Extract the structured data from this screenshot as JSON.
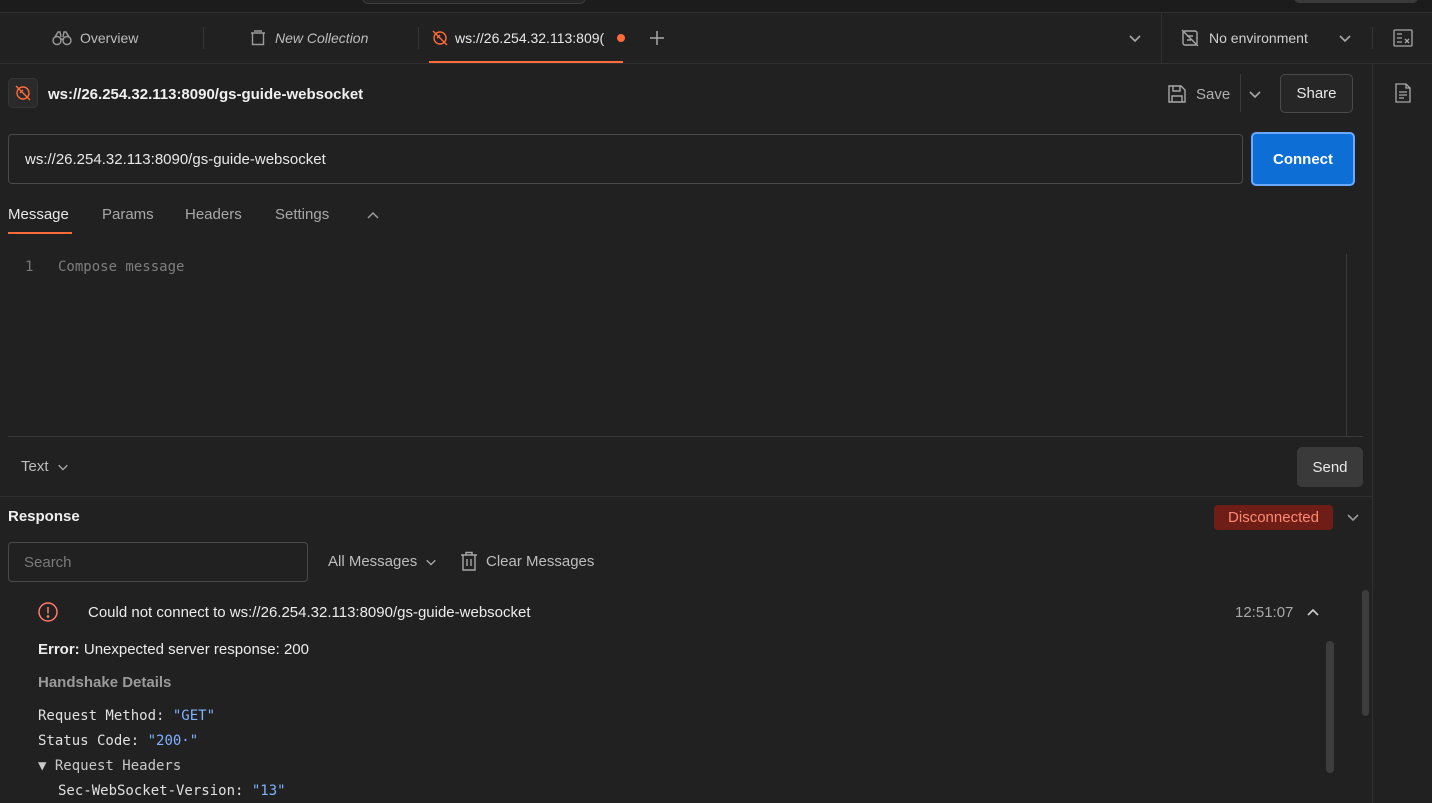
{
  "tabs": {
    "overview": "Overview",
    "collection": "New Collection",
    "active": "ws://26.254.32.113:809(",
    "environment": "No environment"
  },
  "request": {
    "title": "ws://26.254.32.113:8090/gs-guide-websocket",
    "url": "ws://26.254.32.113:8090/gs-guide-websocket",
    "save_label": "Save",
    "share_label": "Share",
    "connect_label": "Connect"
  },
  "subtabs": {
    "message": "Message",
    "params": "Params",
    "headers": "Headers",
    "settings": "Settings"
  },
  "editor": {
    "line_number": "1",
    "placeholder": "Compose message",
    "format": "Text",
    "send_label": "Send"
  },
  "response": {
    "title": "Response",
    "status": "Disconnected",
    "search_placeholder": "Search",
    "filter": "All Messages",
    "clear_label": "Clear Messages",
    "event_text": "Could not connect to ws://26.254.32.113:8090/gs-guide-websocket",
    "event_time": "12:51:07",
    "error_label": "Error:",
    "error_text": "Unexpected server response: 200",
    "handshake_title": "Handshake Details",
    "method_key": "Request Method:",
    "method_val": "\"GET\"",
    "status_key": "Status Code:",
    "status_val": "\"200·\"",
    "headers_toggle": "▼ Request Headers",
    "ws_version_key": "Sec-WebSocket-Version:",
    "ws_version_val": "\"13\""
  },
  "colors": {
    "accent": "#ff6c37",
    "connect": "#0d6fd6",
    "error": "#ff8a72",
    "string": "#7fb2ff"
  }
}
